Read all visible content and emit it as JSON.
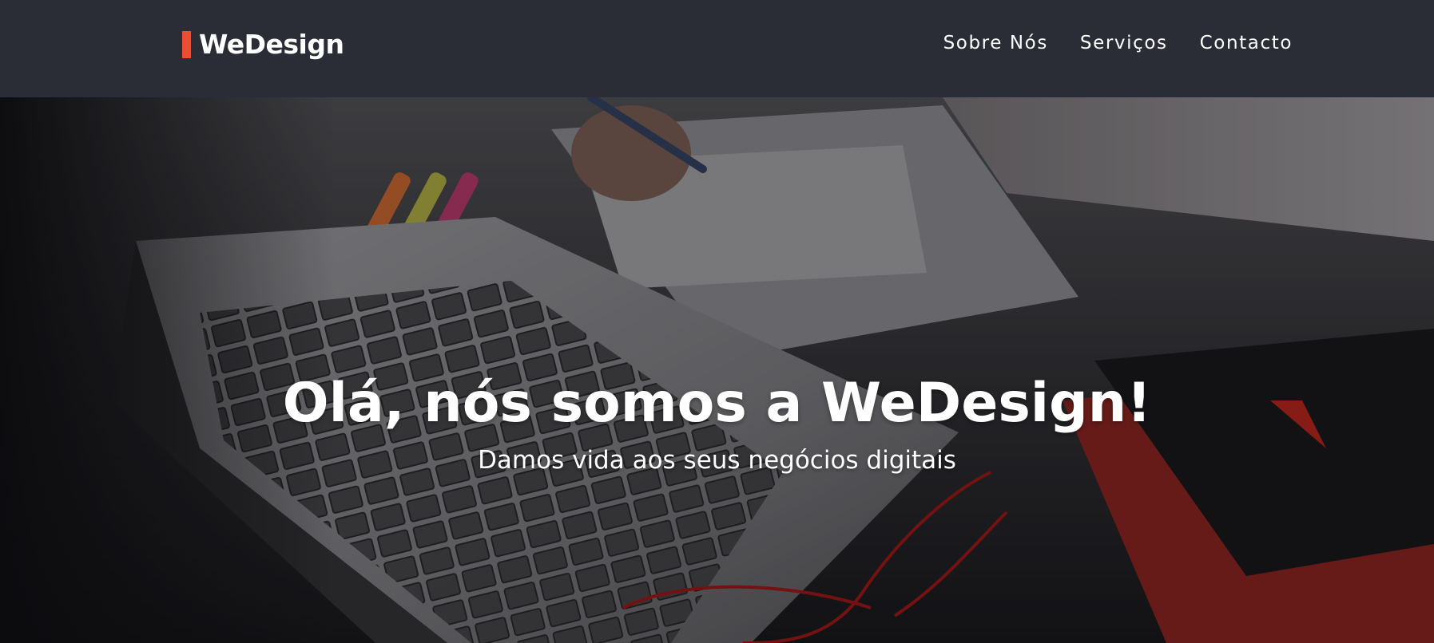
{
  "brand": {
    "name": "WeDesign",
    "accent_color": "#ea4e35"
  },
  "nav": {
    "items": [
      {
        "label": "Sobre Nós"
      },
      {
        "label": "Serviços"
      },
      {
        "label": "Contacto"
      }
    ]
  },
  "hero": {
    "title": "Olá, nós somos a WeDesign!",
    "subtitle": "Damos vida aos seus negócios digitais",
    "background_image": "laptop-desk-photo"
  },
  "colors": {
    "header_bg": "#2b2d36",
    "text": "#ffffff"
  }
}
